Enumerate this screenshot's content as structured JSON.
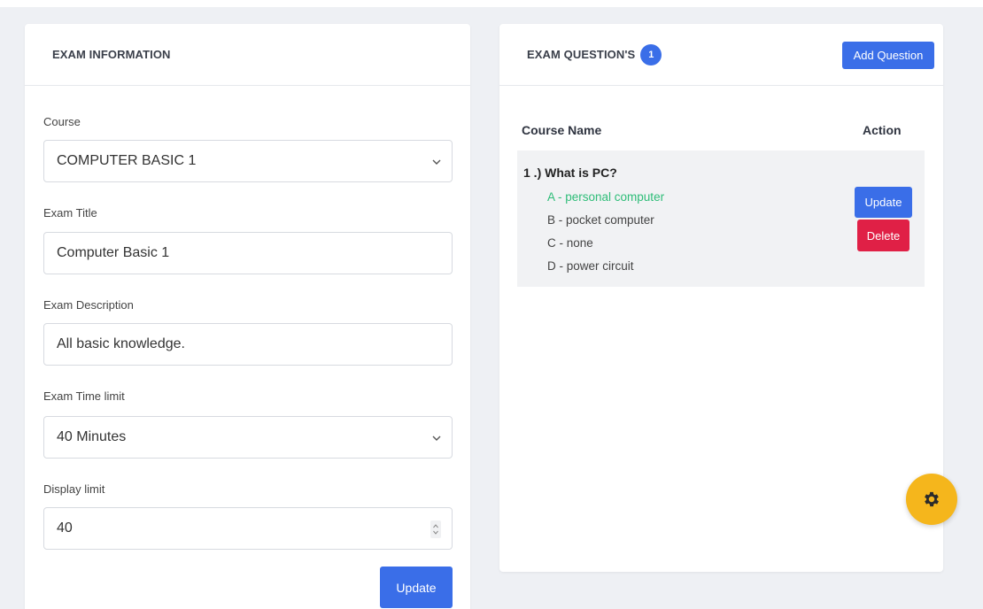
{
  "exam_info": {
    "title": "EXAM INFORMATION",
    "course_label": "Course",
    "course_value": "COMPUTER BASIC 1",
    "exam_title_label": "Exam Title",
    "exam_title_value": "Computer Basic 1",
    "description_label": "Exam Description",
    "description_value": "All basic knowledge.",
    "time_limit_label": "Exam Time limit",
    "time_limit_value": "40 Minutes",
    "display_limit_label": "Display limit",
    "display_limit_value": "40",
    "update_label": "Update"
  },
  "exam_questions": {
    "title": "EXAM QUESTION'S",
    "count": "1",
    "add_label": "Add Question",
    "col_course_name": "Course Name",
    "col_action": "Action",
    "questions": [
      {
        "title": "1 .) What is PC?",
        "options": [
          "A - personal computer",
          "B - pocket computer",
          "C - none",
          "D - power circuit"
        ],
        "update_label": "Update",
        "delete_label": "Delete"
      }
    ]
  },
  "colors": {
    "primary": "#3a6ee8",
    "danger": "#e02046",
    "correct_answer": "#2ebd78",
    "fab": "#f5b61c"
  },
  "icons": {
    "fab": "gear-icon",
    "select": "chevron-down-icon",
    "number": "spinner-icon"
  }
}
